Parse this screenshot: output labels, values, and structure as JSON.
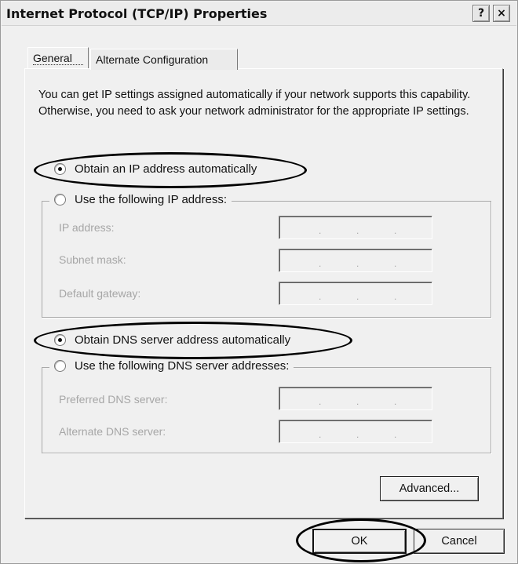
{
  "window": {
    "title": "Internet Protocol (TCP/IP) Properties",
    "help_button": "?",
    "close_button": "×"
  },
  "tabs": [
    {
      "label": "General",
      "selected": true
    },
    {
      "label": "Alternate Configuration",
      "selected": false
    }
  ],
  "general": {
    "intro_text": "You can get IP settings assigned automatically if your network supports this capability. Otherwise, you need to ask your network administrator for the appropriate IP settings.",
    "ip_mode": {
      "auto_label": "Obtain an IP address automatically",
      "auto_selected": true,
      "manual_label": "Use the following IP address:",
      "manual_selected": false
    },
    "ip_fields": [
      {
        "label": "IP address:",
        "value": "",
        "enabled": false
      },
      {
        "label": "Subnet mask:",
        "value": "",
        "enabled": false
      },
      {
        "label": "Default gateway:",
        "value": "",
        "enabled": false
      }
    ],
    "dns_mode": {
      "auto_label": "Obtain DNS server address automatically",
      "auto_selected": true,
      "manual_label": "Use the following DNS server addresses:",
      "manual_selected": false
    },
    "dns_fields": [
      {
        "label": "Preferred DNS server:",
        "value": "",
        "enabled": false
      },
      {
        "label": "Alternate DNS server:",
        "value": "",
        "enabled": false
      }
    ],
    "advanced_label": "Advanced..."
  },
  "buttons": {
    "ok_label": "OK",
    "cancel_label": "Cancel"
  },
  "colors": {
    "dialog_bg": "#f0f0f0",
    "disabled_text": "#a6a6a6",
    "annotation_ring": "#000000"
  }
}
